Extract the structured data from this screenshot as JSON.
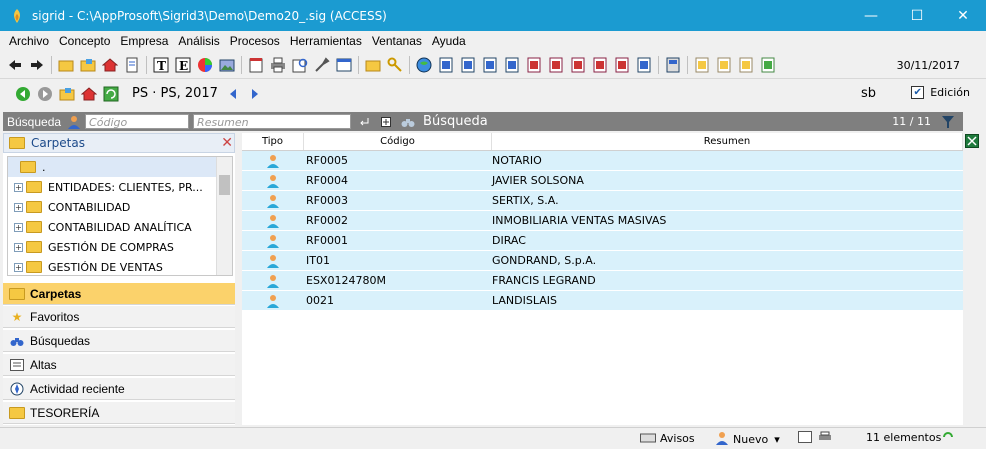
{
  "window": {
    "title": "sigrid - C:\\AppProsoft\\Sigrid3\\Demo\\Demo20_.sig (ACCESS)",
    "minimize": "—",
    "maximize": "☐",
    "close": "✕"
  },
  "menu": [
    "Archivo",
    "Concepto",
    "Empresa",
    "Análisis",
    "Procesos",
    "Herramientas",
    "Ventanas",
    "Ayuda"
  ],
  "toolbar": {
    "date": "30/11/2017"
  },
  "context": {
    "label": "PS · PS, 2017",
    "user": "sb",
    "edit_label": "Edición",
    "edit_checked": "✔"
  },
  "search": {
    "label": "Búsqueda",
    "code_placeholder": "Código",
    "summary_placeholder": "Resumen",
    "title": "Búsqueda",
    "count": "11 / 11"
  },
  "left_panel": {
    "header": "Carpetas",
    "tree": [
      ".",
      "ENTIDADES: CLIENTES, PR...",
      "CONTABILIDAD",
      "CONTABILIDAD ANALÍTICA",
      "GESTIÓN DE COMPRAS",
      "GESTIÓN DE VENTAS"
    ],
    "sections": [
      "Carpetas",
      "Favoritos",
      "Búsquedas",
      "Altas",
      "Actividad reciente",
      "TESORERÍA"
    ]
  },
  "grid": {
    "columns": [
      "Tipo",
      "Código",
      "Resumen"
    ],
    "rows": [
      {
        "code": "RF0005",
        "summary": "NOTARIO"
      },
      {
        "code": "RF0004",
        "summary": "JAVIER SOLSONA"
      },
      {
        "code": "RF0003",
        "summary": "SERTIX, S.A."
      },
      {
        "code": "RF0002",
        "summary": "INMOBILIARIA VENTAS MASIVAS"
      },
      {
        "code": "RF0001",
        "summary": "DIRAC"
      },
      {
        "code": "IT01",
        "summary": "GONDRAND, S.p.A."
      },
      {
        "code": "ESX0124780M",
        "summary": "FRANCIS LEGRAND"
      },
      {
        "code": "0021",
        "summary": "LANDISLAIS"
      }
    ]
  },
  "status": {
    "notices": "Avisos",
    "new": "Nuevo",
    "count": "11 elementos"
  }
}
